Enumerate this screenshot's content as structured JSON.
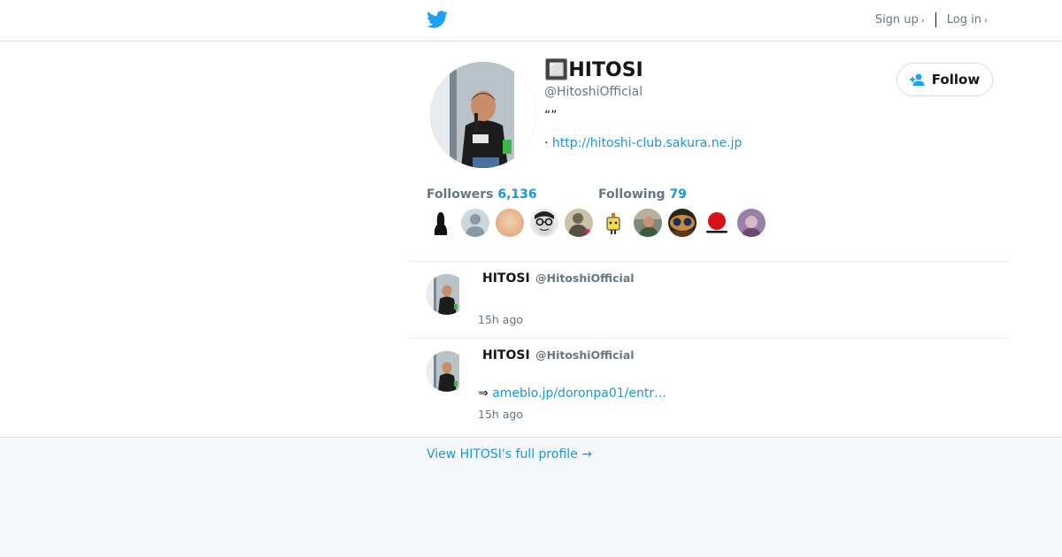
{
  "header": {
    "logo": "twitter-bird-icon",
    "signup_label": "Sign up",
    "login_label": "Log in",
    "chevron": "›"
  },
  "profile": {
    "name": "🔲HITOSI",
    "handle": "@HitoshiOfficial",
    "bio": "“”",
    "url_prefix": "·",
    "url": "http://hitoshi-club.sakura.ne.jp",
    "follow_label": "Follow",
    "followers_label": "Followers",
    "followers_count": "6,136",
    "following_label": "Following",
    "following_count": "79"
  },
  "tweets": [
    {
      "name": "HITOSI",
      "handle": "@HitoshiOfficial",
      "text_prefix": "",
      "link": "",
      "time": "15h ago"
    },
    {
      "name": "HITOSI",
      "handle": "@HitoshiOfficial",
      "text_prefix": "⇒",
      "link": "ameblo.jp/doronpa01/entr…",
      "time": "15h ago"
    }
  ],
  "footer": {
    "full_profile_label": "View HITOSI's full profile →"
  },
  "colors": {
    "accent": "#1b95e0",
    "muted": "#657786",
    "border": "#d9dde1",
    "footer_bg": "#f5f8fa"
  }
}
